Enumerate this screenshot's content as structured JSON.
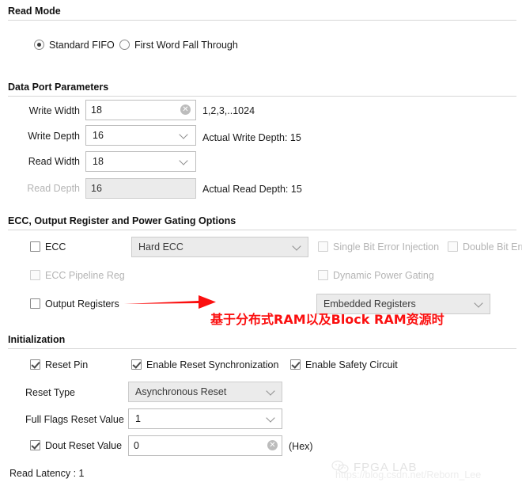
{
  "sections": {
    "read_mode": {
      "title": "Read Mode",
      "options": [
        {
          "label": "Standard FIFO",
          "selected": true
        },
        {
          "label": "First Word Fall Through",
          "selected": false
        }
      ]
    },
    "data_port": {
      "title": "Data Port Parameters",
      "rows": [
        {
          "label": "Write Width",
          "value": "18",
          "hint": "1,2,3,..1024"
        },
        {
          "label": "Write Depth",
          "value": "16",
          "hint": "Actual Write Depth: 15"
        },
        {
          "label": "Read Width",
          "value": "18",
          "hint": ""
        },
        {
          "label": "Read Depth",
          "value": "16",
          "hint": "Actual Read Depth: 15"
        }
      ]
    },
    "ecc": {
      "title": "ECC, Output Register and Power Gating Options",
      "ecc_checkbox": "ECC",
      "ecc_mode": "Hard ECC",
      "single_bit": "Single Bit Error Injection",
      "double_bit": "Double Bit Error Injection",
      "pipeline_reg": "ECC Pipeline Reg",
      "dynamic_power_gating": "Dynamic Power Gating",
      "output_registers": "Output Registers",
      "output_register_type": "Embedded Registers"
    },
    "initialization": {
      "title": "Initialization",
      "reset_pin": "Reset Pin",
      "enable_reset_sync": "Enable Reset Synchronization",
      "enable_safety_circuit": "Enable Safety Circuit",
      "reset_type_label": "Reset Type",
      "reset_type_value": "Asynchronous Reset",
      "full_flags_label": "Full Flags Reset Value",
      "full_flags_value": "1",
      "dout_reset_label": "Dout Reset Value",
      "dout_reset_value": "0",
      "hex_note": "(Hex)"
    },
    "footer": {
      "read_latency": "Read Latency : 1"
    }
  },
  "annotation": {
    "text": "基于分布式RAM以及Block RAM资源时",
    "color": "#fb0f0f"
  },
  "watermark": {
    "url": "https://blog.csdn.net/Reborn_Lee",
    "brand": "FPGA LAB"
  }
}
